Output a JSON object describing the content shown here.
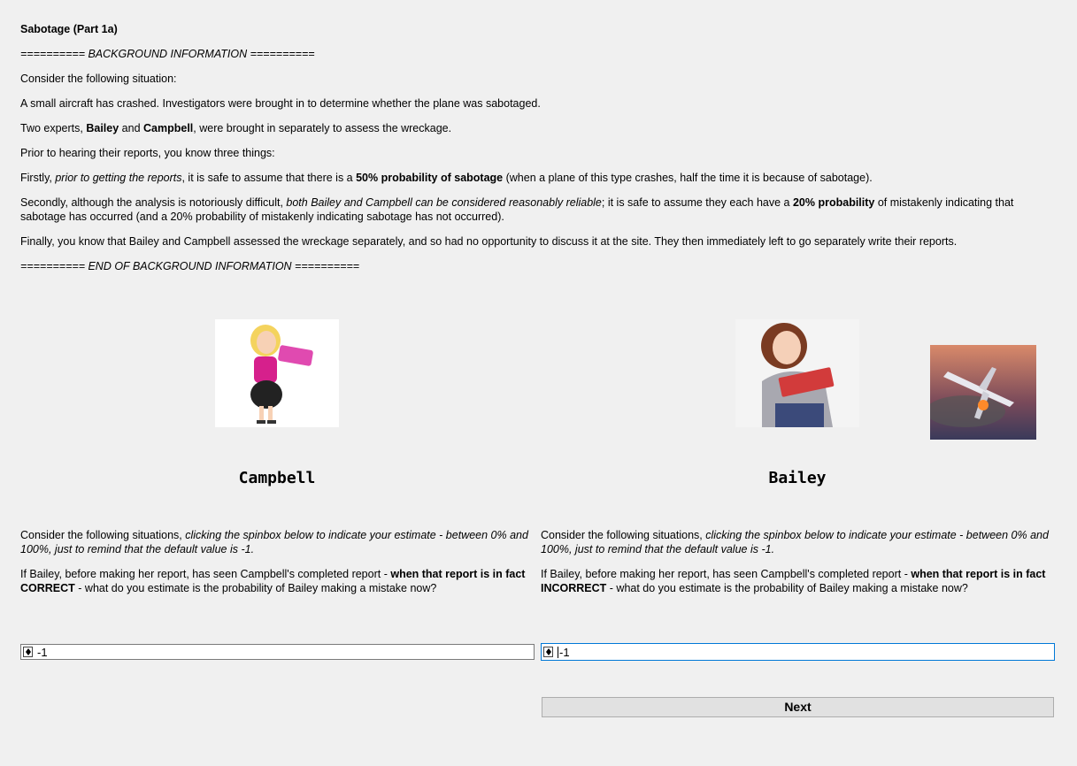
{
  "title": "Sabotage (Part 1a)",
  "bg_start": "========== BACKGROUND INFORMATION ==========",
  "p1": "Consider the following situation:",
  "p2": "A small aircraft has crashed. Investigators were brought in to determine whether the plane was sabotaged.",
  "p3": {
    "a": "Two experts, ",
    "b1": "Bailey",
    "c": " and ",
    "b2": "Campbell",
    "d": ", were brought in separately to assess the wreckage."
  },
  "p4": "Prior to hearing their reports, you know three things:",
  "p5": {
    "a": "Firstly, ",
    "i": "prior to getting the reports",
    "c": ", it is safe to assume that there is a ",
    "b": "50% probability of sabotage",
    "d": " (when a plane of this type crashes, half the time it is because of sabotage)."
  },
  "p6": {
    "a": "Secondly, although the analysis is notoriously difficult, ",
    "i": "both Bailey and Campbell can be considered reasonably reliable",
    "c": "; it is safe to assume they each have a ",
    "b": "20% probability",
    "d": " of mistakenly indicating that sabotage has occurred (and a 20% probability of mistakenly indicating sabotage has not occurred)."
  },
  "p7": "Finally, you know that Bailey and Campbell assessed the wreckage separately, and so had no opportunity to discuss it at the site. They then immediately left to go separately write their reports.",
  "bg_end": "========== END OF BACKGROUND INFORMATION ==========",
  "names": {
    "left": "Campbell",
    "right": "Bailey"
  },
  "columns": [
    {
      "intro_a": "Consider the following situations, ",
      "intro_i": "clicking the spinbox below to indicate your estimate - between 0% and 100%, just to remind that the default value is -1.",
      "q_a": "If Bailey, before making her report, has seen Campbell's completed report - ",
      "q_b": "when that report is in fact CORRECT",
      "q_c": " - what do you estimate is the probability of Bailey making a mistake now?",
      "value": "-1"
    },
    {
      "intro_a": "Consider the following situations, ",
      "intro_i": "clicking the spinbox below to indicate your estimate - between 0% and 100%, just to remind that the default value is -1.",
      "q_a": "If Bailey, before making her report, has seen Campbell's completed report - ",
      "q_b": "when that report is in fact INCORRECT",
      "q_c": " - what do you estimate is the probability of Bailey making a mistake now?",
      "value": "-1"
    }
  ],
  "next_label": "Next"
}
